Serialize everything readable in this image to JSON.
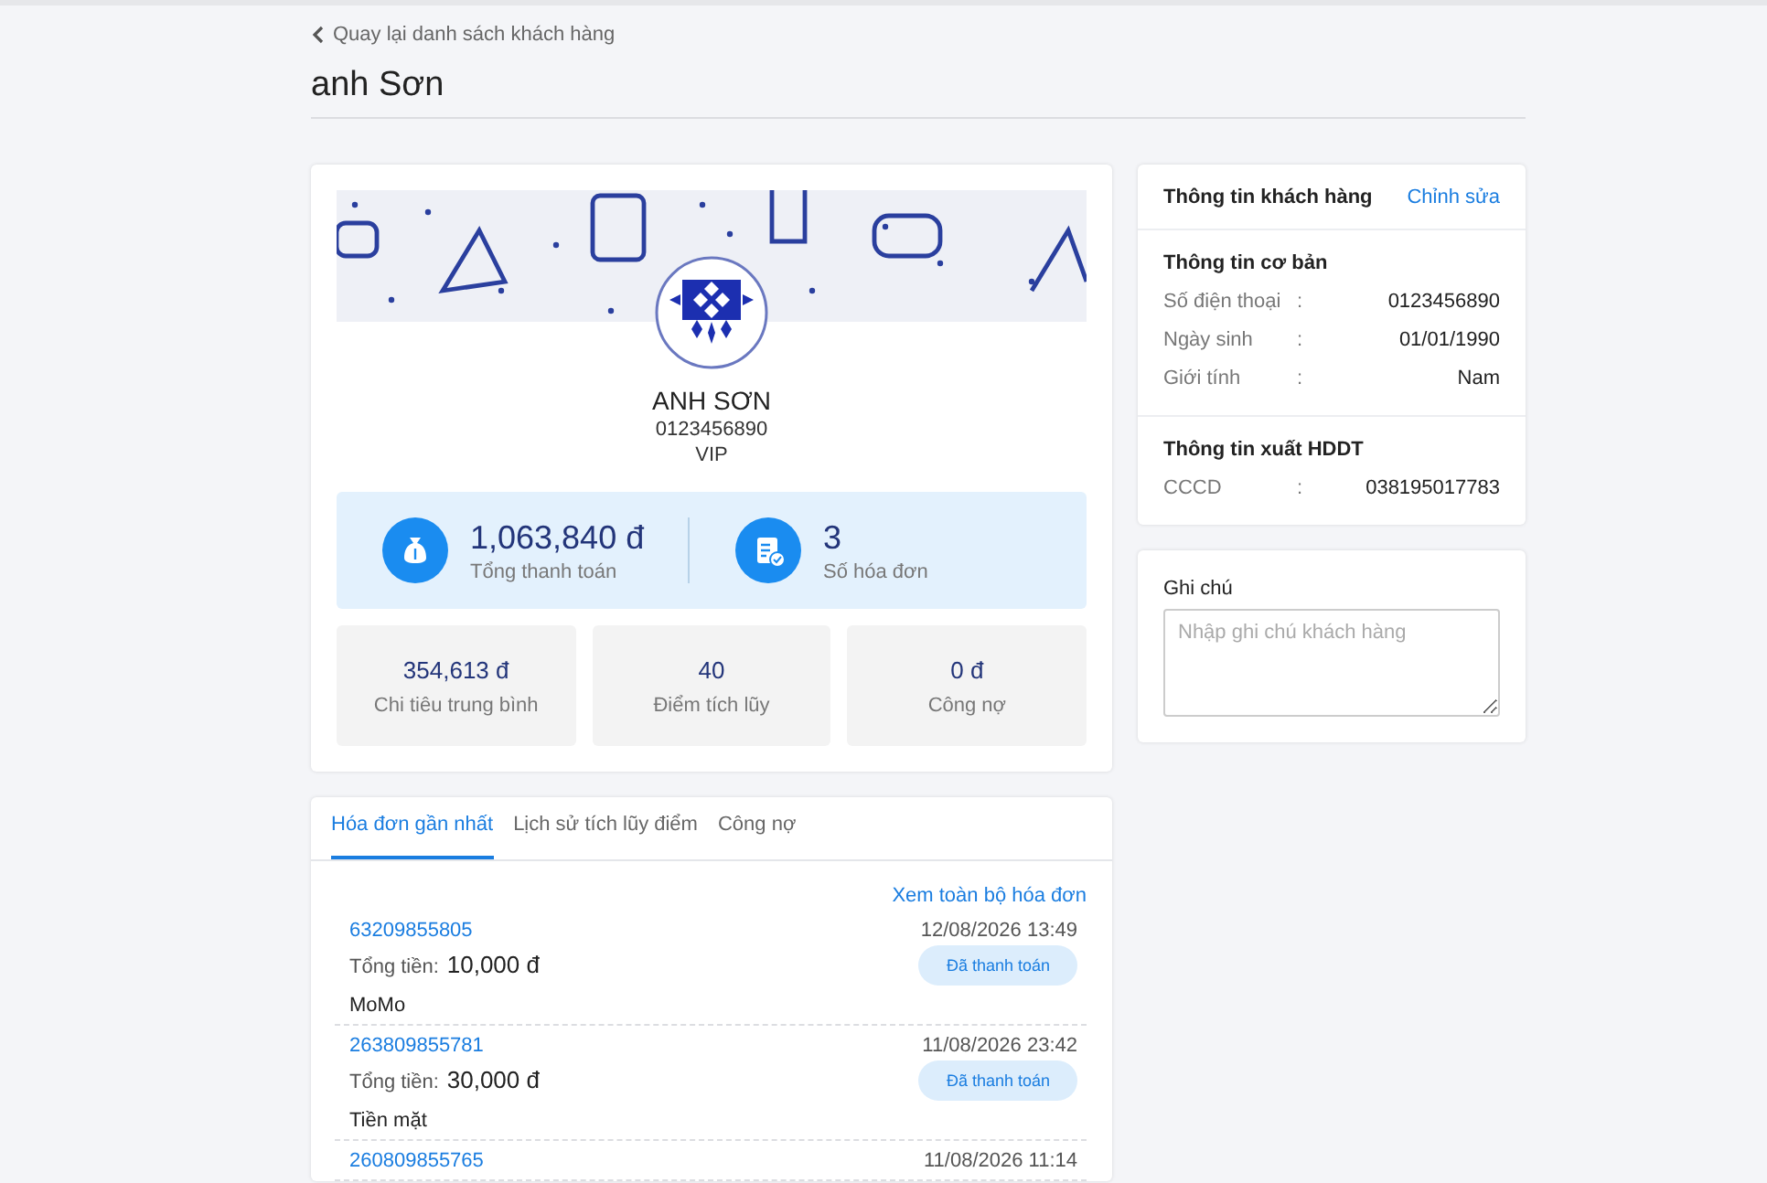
{
  "back_link": "Quay lại danh sách khách hàng",
  "page_title": "anh Sơn",
  "profile": {
    "name": "ANH SƠN",
    "phone": "0123456890",
    "tier": "VIP"
  },
  "highlights": [
    {
      "kind": "money",
      "value": "1,063,840 đ",
      "label": "Tổng thanh toán"
    },
    {
      "kind": "invoices",
      "value": "3",
      "label": "Số hóa đơn"
    }
  ],
  "stats": [
    {
      "value": "354,613 đ",
      "label": "Chi tiêu trung bình"
    },
    {
      "value": "40",
      "label": "Điểm tích lũy"
    },
    {
      "value": "0 đ",
      "label": "Công nợ"
    }
  ],
  "tabs": [
    {
      "label": "Hóa đơn gần nhất",
      "selected": true
    },
    {
      "label": "Lịch sử tích lũy điểm",
      "selected": false
    },
    {
      "label": "Công nợ",
      "selected": false
    }
  ],
  "view_all_link": "Xem toàn bộ hóa đơn",
  "invoices": [
    {
      "id": "63209855805",
      "date": "12/08/2026 13:49",
      "total_label": "Tổng tiền:",
      "total": "10,000 đ",
      "status": "Đã thanh toán",
      "method": "MoMo"
    },
    {
      "id": "263809855781",
      "date": "11/08/2026 23:42",
      "total_label": "Tổng tiền:",
      "total": "30,000 đ",
      "status": "Đã thanh toán",
      "method": "Tiền mặt"
    },
    {
      "id": "260809855765",
      "date": "11/08/2026 11:14"
    }
  ],
  "customer_info": {
    "title": "Thông tin khách hàng",
    "edit_link": "Chỉnh sửa",
    "sections": [
      {
        "title": "Thông tin cơ bản",
        "rows": [
          {
            "label": "Số điện thoại",
            "separator": ":",
            "value": "0123456890"
          },
          {
            "label": "Ngày sinh",
            "separator": ":",
            "value": "01/01/1990"
          },
          {
            "label": "Giới tính",
            "separator": ":",
            "value": "Nam"
          }
        ]
      },
      {
        "title": "Thông tin xuất HDDT",
        "rows": [
          {
            "label": "CCCD",
            "separator": ":",
            "value": "038195017783"
          }
        ]
      }
    ]
  },
  "notes": {
    "label": "Ghi chú",
    "placeholder": "Nhập ghi chú khách hàng"
  }
}
